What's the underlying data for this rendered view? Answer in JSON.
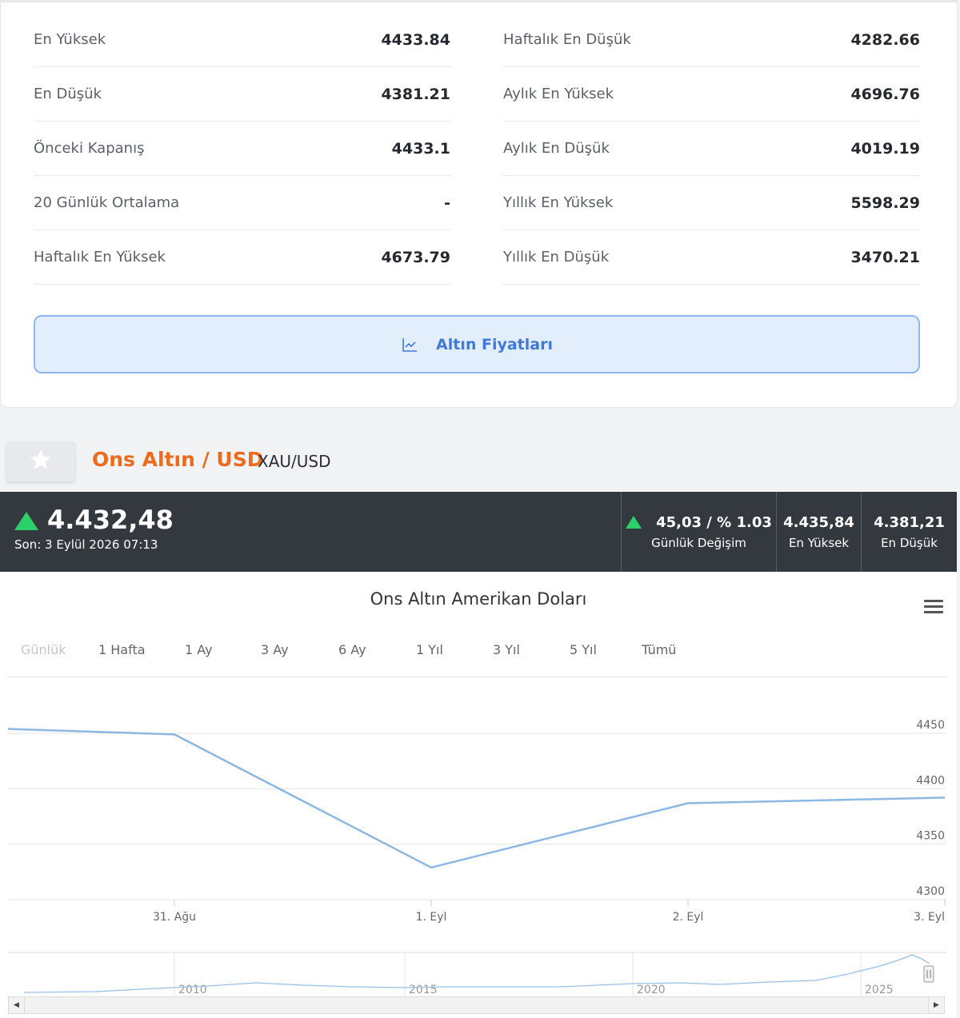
{
  "stats": {
    "left": [
      {
        "label": "En Yüksek",
        "value": "4433.84"
      },
      {
        "label": "En Düşük",
        "value": "4381.21"
      },
      {
        "label": "Önceki Kapanış",
        "value": "4433.1"
      },
      {
        "label": "20 Günlük Ortalama",
        "value": "-"
      },
      {
        "label": "Haftalık En Yüksek",
        "value": "4673.79"
      }
    ],
    "right": [
      {
        "label": "Haftalık En Düşük",
        "value": "4282.66"
      },
      {
        "label": "Aylık En Yüksek",
        "value": "4696.76"
      },
      {
        "label": "Aylık En Düşük",
        "value": "4019.19"
      },
      {
        "label": "Yıllık En Yüksek",
        "value": "5598.29"
      },
      {
        "label": "Yıllık En Düşük",
        "value": "3470.21"
      }
    ],
    "button_label": "Altın Fiyatları",
    "button_icon": "line-chart-icon"
  },
  "instrument": {
    "favorite_icon": "star-icon",
    "title": "Ons Altın / USD",
    "symbol": "XAU/USD"
  },
  "quote": {
    "price": "4.432,48",
    "last_update": "Son: 3 Eylül 2026 07:13",
    "change": "45,03 / % 1.03",
    "change_label": "Günlük Değişim",
    "high": "4.435,84",
    "high_label": "En Yüksek",
    "low": "4.381,21",
    "low_label": "En Düşük",
    "up_color": "#2bd168"
  },
  "chart": {
    "title": "Ons Altın Amerikan Doları",
    "menu_icon": "hamburger-menu-icon",
    "range_tabs": [
      "Günlük",
      "1 Hafta",
      "1 Ay",
      "3 Ay",
      "6 Ay",
      "1 Yıl",
      "3 Yıl",
      "5 Yıl",
      "Tümü"
    ],
    "active_tab": "Günlük",
    "line_color": "#8db8e2",
    "navigator_labels": [
      "2010",
      "2015",
      "2020",
      "2025"
    ]
  },
  "chart_data": {
    "type": "line",
    "title": "Ons Altın Amerikan Doları",
    "x_ticks": [
      "31. Ağu",
      "1. Eyl",
      "2. Eyl",
      "3. Eyl"
    ],
    "y_ticks": [
      4450,
      4400,
      4350,
      4300
    ],
    "ylim": [
      4300,
      4450
    ],
    "grid": true,
    "y_axis_side": "right",
    "series": [
      {
        "x": [
          "30. Ağu",
          "31. Ağu",
          "1. Eyl",
          "2. Eyl",
          "3. Eyl"
        ],
        "values": [
          4454,
          4449,
          4329,
          4387,
          4392
        ]
      }
    ]
  }
}
